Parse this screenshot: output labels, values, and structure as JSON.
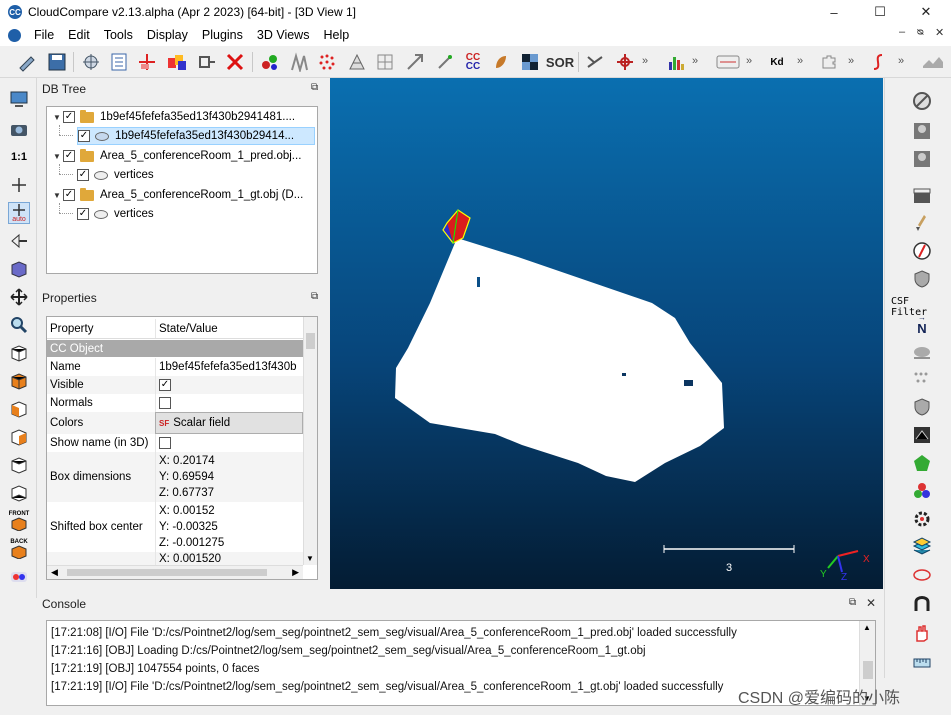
{
  "window": {
    "title": "CloudCompare v2.13.alpha (Apr  2 2023) [64-bit] - [3D View 1]",
    "controls": [
      "–",
      "☐",
      "✕"
    ]
  },
  "menu": [
    "File",
    "Edit",
    "Tools",
    "Display",
    "Plugins",
    "3D Views",
    "Help"
  ],
  "mdi_controls": [
    "–",
    "ᴓ",
    "✕"
  ],
  "toolbar": {
    "cc_label": "CC",
    "sor_label": "SOR",
    "kd_label": "Kd",
    "chevron": "»"
  },
  "left_toolbar": {
    "one_to_one": "1:1",
    "auto": "auto",
    "front": "FRONT",
    "back": "BACK"
  },
  "right_toolbar": {
    "csf_label": "CSF Filter",
    "n_label": "N"
  },
  "db_tree": {
    "header": "DB Tree",
    "items": [
      {
        "label": "1b9ef45fefefa35ed13f430b2941481....",
        "checked": "✓",
        "level": 0,
        "kind": "folder",
        "expanded": "▼"
      },
      {
        "label": "1b9ef45fefefa35ed13f430b29414...",
        "checked": "✓",
        "level": 1,
        "kind": "cloud",
        "selected": true
      },
      {
        "label": "Area_5_conferenceRoom_1_pred.obj...",
        "checked": "✓",
        "level": 0,
        "kind": "folder",
        "expanded": "▼"
      },
      {
        "label": "vertices",
        "checked": "✓",
        "level": 1,
        "kind": "cloud"
      },
      {
        "label": "Area_5_conferenceRoom_1_gt.obj (D...",
        "checked": "✓",
        "level": 0,
        "kind": "folder",
        "expanded": "▼"
      },
      {
        "label": "vertices",
        "checked": "✓",
        "level": 1,
        "kind": "cloud"
      }
    ]
  },
  "properties": {
    "header": "Properties",
    "col_property": "Property",
    "col_value": "State/Value",
    "section": "CC Object",
    "name_label": "Name",
    "name_value": "1b9ef45fefefa35ed13f430b",
    "visible_label": "Visible",
    "visible_check": "✓",
    "normals_label": "Normals",
    "colors_label": "Colors",
    "colors_value": "Scalar field",
    "showname_label": "Show name (in 3D)",
    "box_label": "Box dimensions",
    "box_x": "X: 0.20174",
    "box_y": "Y: 0.69594",
    "box_z": "Z: 0.67737",
    "shift_label": "Shifted box center",
    "shift_x": "X: 0.00152",
    "shift_y": "Y: -0.00325",
    "shift_z": "Z: -0.001275",
    "extra_x": "X: 0.001520"
  },
  "view": {
    "scale_label": "3",
    "axis_x": "X",
    "axis_y": "Y",
    "axis_z": "Z",
    "bg_top": "#0a6fb0",
    "bg_bottom": "#041c33"
  },
  "console": {
    "header": "Console",
    "lines": [
      "[17:21:08] [I/O] File 'D:/cs/Pointnet2/log/sem_seg/pointnet2_sem_seg/visual/Area_5_conferenceRoom_1_pred.obj' loaded successfully",
      "[17:21:16] [OBJ] Loading D:/cs/Pointnet2/log/sem_seg/pointnet2_sem_seg/visual/Area_5_conferenceRoom_1_gt.obj",
      "[17:21:19] [OBJ] 1047554 points, 0 faces",
      "[17:21:19] [I/O] File 'D:/cs/Pointnet2/log/sem_seg/pointnet2_sem_seg/visual/Area_5_conferenceRoom_1_gt.obj' loaded successfully"
    ]
  },
  "watermark": "CSDN @爱编码的小陈"
}
